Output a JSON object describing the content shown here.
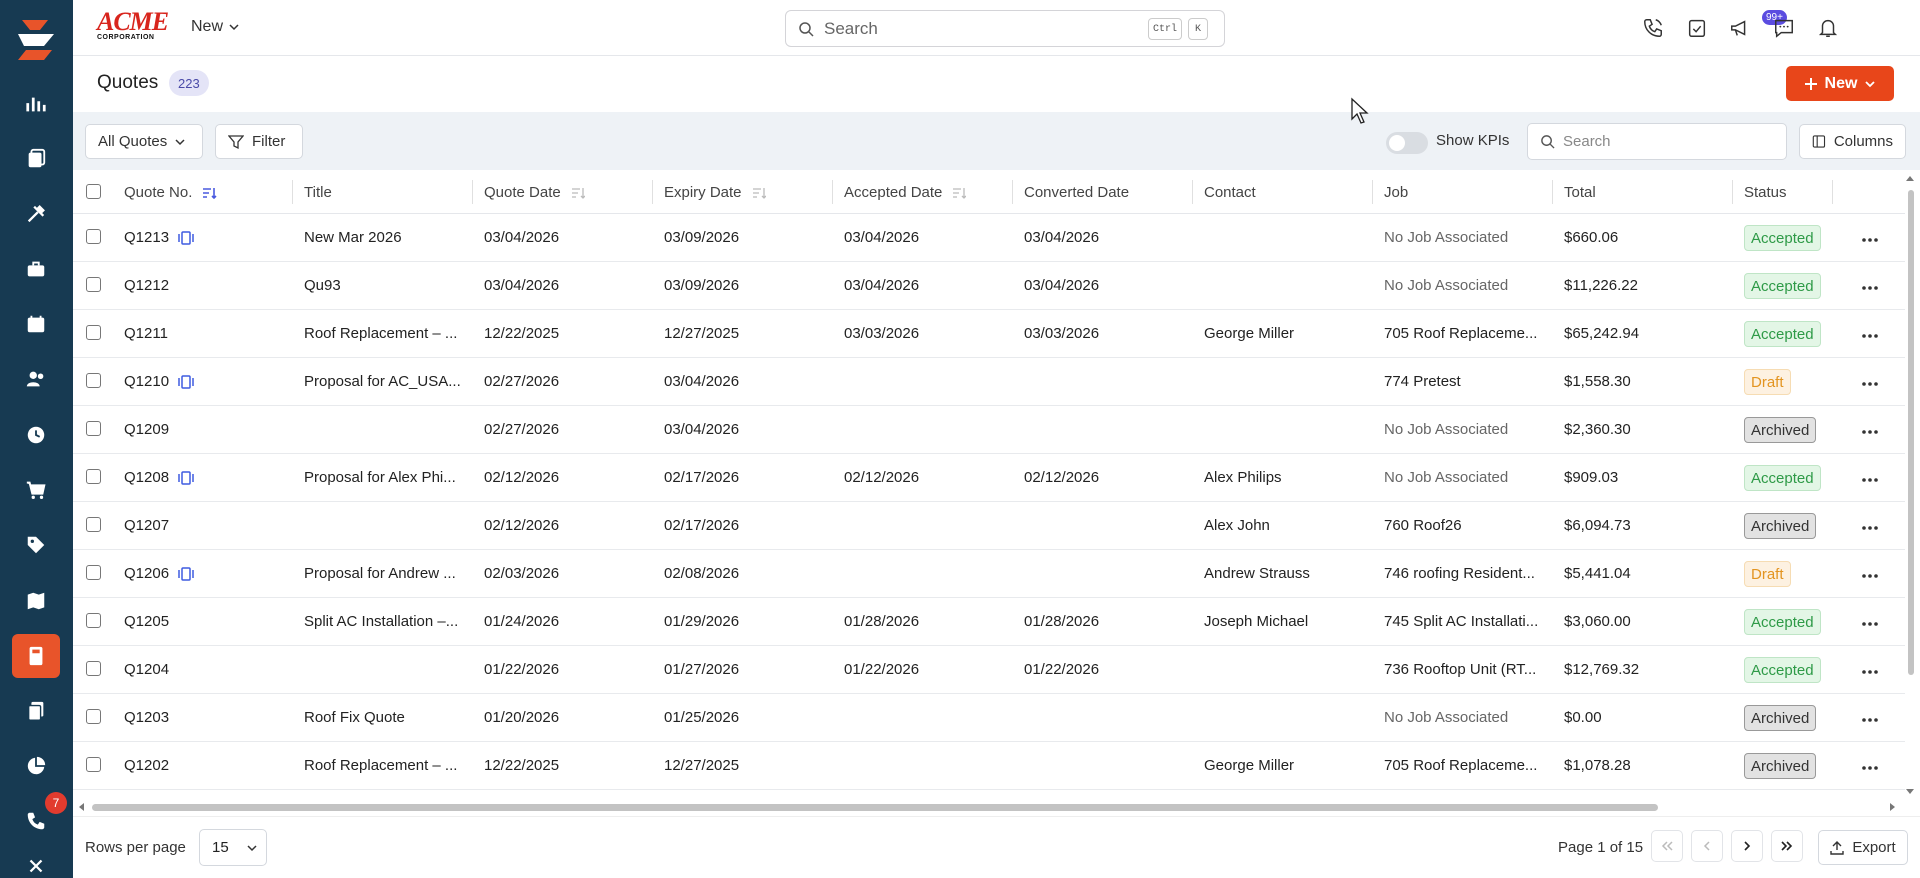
{
  "app": {
    "logo_text": "ACME",
    "logo_subtext": "CORPORATION",
    "new_menu_label": "New"
  },
  "search": {
    "placeholder": "Search",
    "kbd1": "Ctrl",
    "kbd2": "K"
  },
  "notifications": {
    "badge": "99+"
  },
  "sidebar": {
    "items": [
      "dashboard-icon",
      "reports-icon",
      "tools-icon",
      "briefcase-icon",
      "calendar-icon",
      "users-icon",
      "clock-icon",
      "cart-icon",
      "tag-icon",
      "map-icon",
      "calculator-icon",
      "documents-icon",
      "pie-chart-icon",
      "phone-icon",
      "more-icon"
    ],
    "active": "calculator-icon",
    "badge": "7"
  },
  "page": {
    "title": "Quotes",
    "count": "223",
    "new_button": "New"
  },
  "toolbar": {
    "view_select": "All Quotes",
    "filter_label": "Filter",
    "kpi_label": "Show KPIs",
    "search_placeholder": "Search",
    "columns_label": "Columns"
  },
  "table": {
    "headers": [
      "Quote No.",
      "Title",
      "Quote Date",
      "Expiry Date",
      "Accepted Date",
      "Converted Date",
      "Contact",
      "Job",
      "Total",
      "Status"
    ],
    "rows": [
      {
        "no": "Q1213",
        "view": true,
        "title": "New Mar 2026",
        "quote_date": "03/04/2026",
        "expiry": "03/09/2026",
        "accepted": "03/04/2026",
        "converted": "03/04/2026",
        "contact": "",
        "job": "No Job Associated",
        "total": "$660.06",
        "status": "Accepted"
      },
      {
        "no": "Q1212",
        "view": false,
        "title": "Qu93",
        "quote_date": "03/04/2026",
        "expiry": "03/09/2026",
        "accepted": "03/04/2026",
        "converted": "03/04/2026",
        "contact": "",
        "job": "No Job Associated",
        "total": "$11,226.22",
        "status": "Accepted"
      },
      {
        "no": "Q1211",
        "view": false,
        "title": "Roof Replacement – ...",
        "quote_date": "12/22/2025",
        "expiry": "12/27/2025",
        "accepted": "03/03/2026",
        "converted": "03/03/2026",
        "contact": "George Miller",
        "job": "705 Roof Replaceme...",
        "total": "$65,242.94",
        "status": "Accepted"
      },
      {
        "no": "Q1210",
        "view": true,
        "title": "Proposal for AC_USA...",
        "quote_date": "02/27/2026",
        "expiry": "03/04/2026",
        "accepted": "",
        "converted": "",
        "contact": "",
        "job": "774 Pretest",
        "total": "$1,558.30",
        "status": "Draft"
      },
      {
        "no": "Q1209",
        "view": false,
        "title": "",
        "quote_date": "02/27/2026",
        "expiry": "03/04/2026",
        "accepted": "",
        "converted": "",
        "contact": "",
        "job": "No Job Associated",
        "total": "$2,360.30",
        "status": "Archived"
      },
      {
        "no": "Q1208",
        "view": true,
        "title": "Proposal for Alex Phi...",
        "quote_date": "02/12/2026",
        "expiry": "02/17/2026",
        "accepted": "02/12/2026",
        "converted": "02/12/2026",
        "contact": "Alex Philips",
        "job": "No Job Associated",
        "total": "$909.03",
        "status": "Accepted"
      },
      {
        "no": "Q1207",
        "view": false,
        "title": "",
        "quote_date": "02/12/2026",
        "expiry": "02/17/2026",
        "accepted": "",
        "converted": "",
        "contact": "Alex John",
        "job": "760 Roof26",
        "total": "$6,094.73",
        "status": "Archived"
      },
      {
        "no": "Q1206",
        "view": true,
        "title": "Proposal for Andrew ...",
        "quote_date": "02/03/2026",
        "expiry": "02/08/2026",
        "accepted": "",
        "converted": "",
        "contact": "Andrew Strauss",
        "job": "746 roofing Resident...",
        "total": "$5,441.04",
        "status": "Draft"
      },
      {
        "no": "Q1205",
        "view": false,
        "title": "Split AC Installation –...",
        "quote_date": "01/24/2026",
        "expiry": "01/29/2026",
        "accepted": "01/28/2026",
        "converted": "01/28/2026",
        "contact": "Joseph Michael",
        "job": "745 Split AC Installati...",
        "total": "$3,060.00",
        "status": "Accepted"
      },
      {
        "no": "Q1204",
        "view": false,
        "title": "",
        "quote_date": "01/22/2026",
        "expiry": "01/27/2026",
        "accepted": "01/22/2026",
        "converted": "01/22/2026",
        "contact": "",
        "job": "736 Rooftop Unit (RT...",
        "total": "$12,769.32",
        "status": "Accepted"
      },
      {
        "no": "Q1203",
        "view": false,
        "title": "Roof Fix Quote",
        "quote_date": "01/20/2026",
        "expiry": "01/25/2026",
        "accepted": "",
        "converted": "",
        "contact": "",
        "job": "No Job Associated",
        "total": "$0.00",
        "status": "Archived"
      },
      {
        "no": "Q1202",
        "view": false,
        "title": "Roof Replacement – ...",
        "quote_date": "12/22/2025",
        "expiry": "12/27/2025",
        "accepted": "",
        "converted": "",
        "contact": "George Miller",
        "job": "705 Roof Replaceme...",
        "total": "$1,078.28",
        "status": "Archived"
      }
    ]
  },
  "footer": {
    "rows_per_page_label": "Rows per page",
    "rows_per_page": "15",
    "page_info": "Page 1 of 15",
    "export_label": "Export"
  },
  "colors": {
    "sidebar": "#173a52",
    "accent": "#e8461a",
    "accepted": "#2e9a47",
    "draft": "#e39420"
  }
}
